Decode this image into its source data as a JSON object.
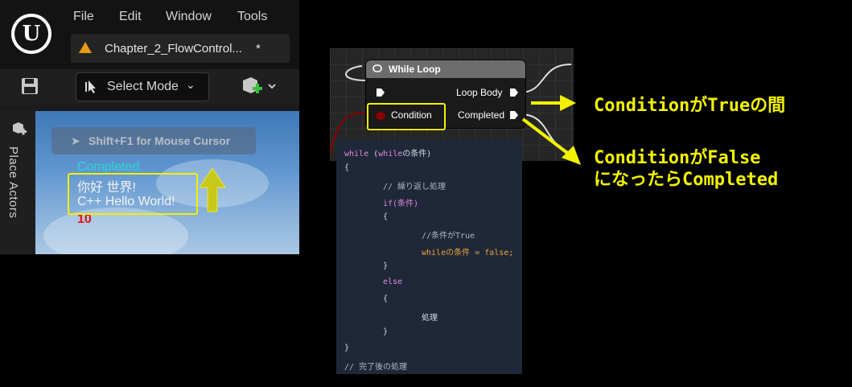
{
  "app": {
    "menu": [
      "File",
      "Edit",
      "Window",
      "Tools"
    ],
    "tab": {
      "title": "Chapter_2_FlowControl...",
      "dirty_marker": "*"
    },
    "toolbar": {
      "select_mode_label": "Select Mode"
    },
    "side_panel": {
      "label": "Place Actors"
    },
    "viewport": {
      "mouse_hint": "Shift+F1 for Mouse Cursor",
      "log_lines": [
        "Completed",
        "你好 世界!",
        "C++ Hello World!",
        "10"
      ],
      "log_colors": {
        "completed": "#29d7d7",
        "text": "#f4f4f4",
        "number": "#e01010"
      }
    }
  },
  "blueprint_node": {
    "title": "While Loop",
    "pins": {
      "condition": "Condition",
      "loop_body": "Loop Body",
      "completed": "Completed"
    }
  },
  "code": {
    "lines": [
      "while (whileの条件)",
      "{",
      "// 繰り返し処理",
      "if(条件)",
      "{",
      "//条件がTrue",
      "whileの条件 = false;",
      "}",
      "else",
      "{",
      "処理",
      "}",
      "}",
      "// 完了後の処理"
    ]
  },
  "annotations": {
    "loop_body_note": "ConditionがTrueの間",
    "completed_note_line1": "ConditionがFalse",
    "completed_note_line2": "になったらCompleted",
    "highlight_color": "#f2f200"
  }
}
